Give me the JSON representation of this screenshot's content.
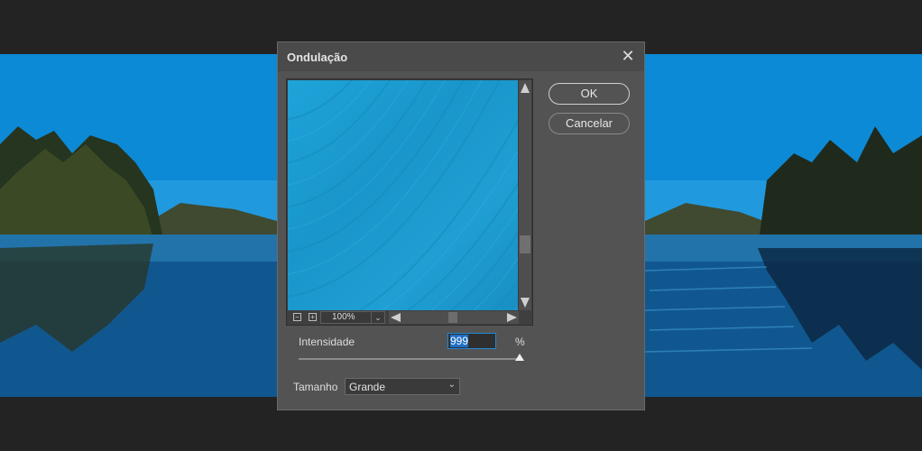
{
  "dialog": {
    "title": "Ondulação",
    "ok_label": "OK",
    "cancel_label": "Cancelar",
    "zoom_level": "100%",
    "intensity_label": "Intensidade",
    "intensity_value": "999",
    "intensity_unit": "%",
    "size_label": "Tamanho",
    "size_value": "Grande"
  },
  "icons": {
    "close": "close-icon",
    "zoom_out": "zoom-out-icon",
    "zoom_in": "zoom-in-icon",
    "dropdown": "chevron-down-icon"
  },
  "colors": {
    "dialog_bg": "#535353",
    "titlebar_bg": "#4a4a4a",
    "input_focus": "#1f8ad6",
    "preview_water": "#1ea3d8"
  }
}
